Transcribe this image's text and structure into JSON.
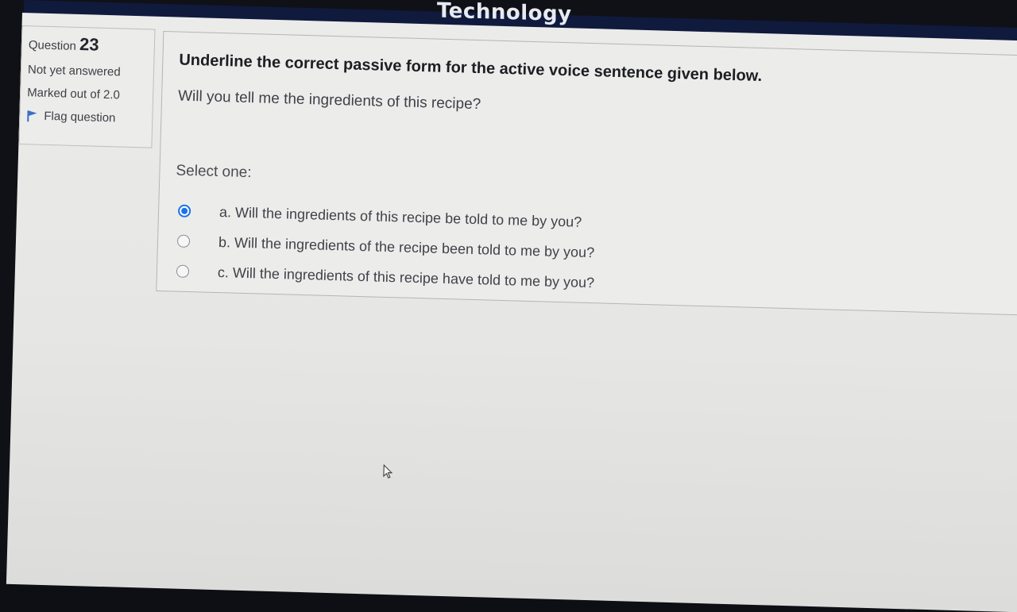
{
  "header": {
    "title": "Technology"
  },
  "question": {
    "label": "Question",
    "number": "23",
    "status": "Not yet answered",
    "marks": "Marked out of 2.0",
    "flag_label": "Flag question"
  },
  "content": {
    "prompt": "Underline the correct passive form for the active voice sentence given below.",
    "sentence": "Will you tell me the ingredients of this recipe?",
    "select_label": "Select one:",
    "options": [
      {
        "label": "a. Will the ingredients of this recipe be told to me by you?",
        "selected": true
      },
      {
        "label": "b. Will the ingredients of the recipe been told to me by you?",
        "selected": false
      },
      {
        "label": "c. Will the ingredients of this recipe have told to me by you?",
        "selected": false
      }
    ]
  },
  "colors": {
    "header_bg": "#0f1a3d",
    "header_accent": "#c2452e",
    "radio_selected": "#1a73e8"
  },
  "icons": {
    "flag": "flag-icon",
    "cursor": "mouse-pointer-icon"
  }
}
